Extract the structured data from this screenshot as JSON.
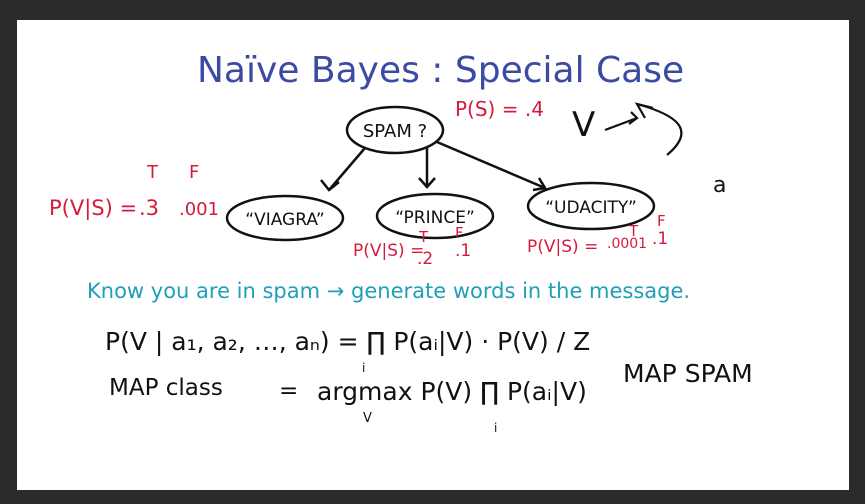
{
  "title": "Naïve Bayes : Special Case",
  "nodes": {
    "root": "SPAM ?",
    "children": [
      "“VIAGRA”",
      "“PRINCE”",
      "“UDACITY”"
    ]
  },
  "prior": "P(S) = .4",
  "viagra_prob": {
    "label": "P(V|S) =",
    "t": ".3",
    "f": ".001"
  },
  "prince_prob": {
    "label": "P(V|S) =",
    "t": ".2",
    "f": ".1"
  },
  "udacity_prob": {
    "label": "P(V|S) = ",
    "t": ".0001",
    "f": ".1"
  },
  "tf_headers": {
    "t": "T",
    "f": "F"
  },
  "side_note": {
    "v": "V",
    "a": "a"
  },
  "explanation": "Know you are in spam → generate words in the message.",
  "formula1": "P(V | a₁, a₂, …, aₙ) = ∏ P(aᵢ|V) · P(V) / Z",
  "formula1_sub": "i",
  "formula2_left": "MAP class",
  "formula2_eq": "=",
  "formula2_right": "argmax P(V) ∏ P(aᵢ|V)",
  "formula2_sub_v": "V",
  "formula2_sub_i": "i",
  "map_label": "MAP SPAM",
  "colors": {
    "blue": "#3b4aa3",
    "red": "#d51b3c",
    "teal": "#1f9fb8",
    "ink": "#111111"
  }
}
